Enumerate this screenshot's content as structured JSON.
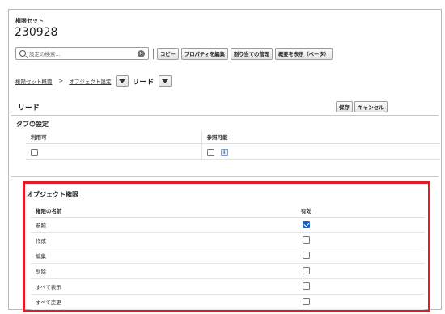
{
  "header": {
    "object_type": "権限セット",
    "object_name": "230928"
  },
  "toolbar": {
    "search_placeholder": "設定の検索...",
    "clear_glyph": "×",
    "buttons": [
      "コピー",
      "プロパティを編集",
      "割り当ての管理",
      "概要を表示（ベータ）"
    ]
  },
  "breadcrumb": {
    "root": "権限セット概要",
    "separator": ">",
    "section": "オブジェクト設定",
    "current": "リード"
  },
  "section": {
    "title": "リード",
    "save_label": "保存",
    "cancel_label": "キャンセル"
  },
  "tab_settings": {
    "title": "タブの設定",
    "columns": [
      "利用可",
      "参照可能"
    ],
    "available": false,
    "visible": false,
    "info_glyph": "i"
  },
  "object_permissions": {
    "title": "オブジェクト権限",
    "columns": [
      "権限の名前",
      "有効"
    ],
    "rows": [
      {
        "name": "参照",
        "enabled": true
      },
      {
        "name": "作成",
        "enabled": false
      },
      {
        "name": "編集",
        "enabled": false
      },
      {
        "name": "削除",
        "enabled": false
      },
      {
        "name": "すべて表示",
        "enabled": false
      },
      {
        "name": "すべて変更",
        "enabled": false
      }
    ]
  },
  "colors": {
    "highlight_border": "#e21b2a",
    "checkbox_checked": "#1b5fc6"
  }
}
